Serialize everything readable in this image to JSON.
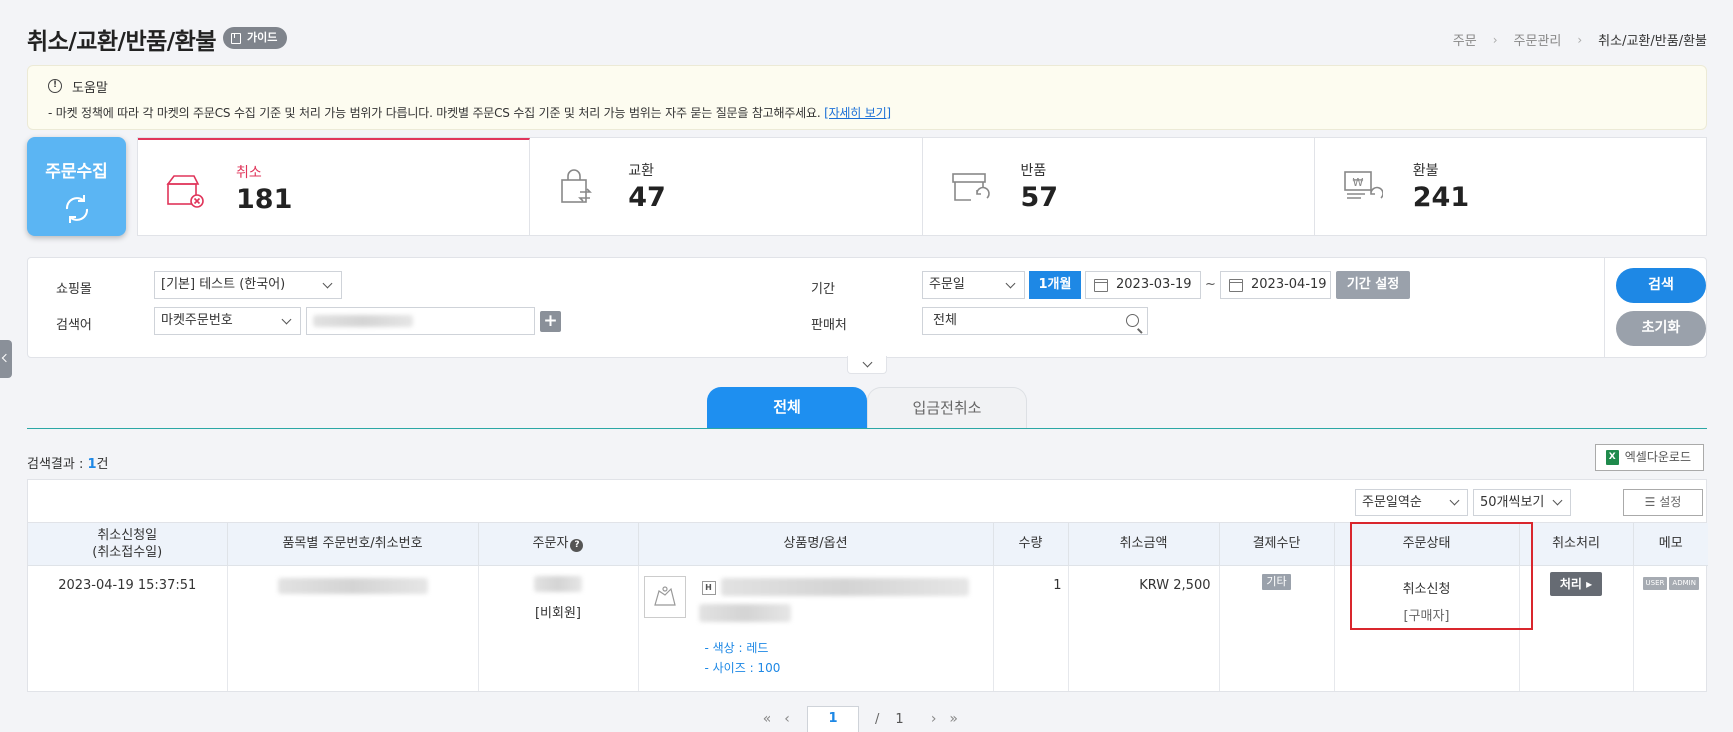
{
  "header": {
    "title": "취소/교환/반품/환불",
    "guide_label": "가이드",
    "breadcrumb": [
      "주문",
      "주문관리",
      "취소/교환/반품/환불"
    ]
  },
  "help": {
    "title": "도움말",
    "text": "- 마켓 정책에 따라 각 마켓의 주문CS 수집 기준 및 처리 가능 범위가 다릅니다. 마켓별 주문CS 수집 기준 및 처리 가능 범위는 자주 묻는 질문을 참고해주세요.",
    "link": "[자세히 보기]"
  },
  "collect": {
    "label": "주문수집"
  },
  "stats": [
    {
      "label": "취소",
      "value": "181",
      "icon": "cancel-box-icon"
    },
    {
      "label": "교환",
      "value": "47",
      "icon": "exchange-bag-icon"
    },
    {
      "label": "반품",
      "value": "57",
      "icon": "return-store-icon"
    },
    {
      "label": "환불",
      "value": "241",
      "icon": "refund-won-icon"
    }
  ],
  "search": {
    "mall_label": "쇼핑몰",
    "mall_value": "[기본] 테스트 (한국어)",
    "keyword_label": "검색어",
    "keyword_type": "마켓주문번호",
    "period_label": "기간",
    "period_type": "주문일",
    "month_btn": "1개월",
    "date_from": "2023-03-19",
    "date_sep": "~",
    "date_to": "2023-04-19",
    "period_set": "기간 설정",
    "seller_label": "판매처",
    "seller_value": "전체",
    "search_btn": "검색",
    "reset_btn": "초기화"
  },
  "tabs": [
    {
      "label": "전체"
    },
    {
      "label": "입금전취소"
    }
  ],
  "result": {
    "prefix": "검색결과 : ",
    "count": "1",
    "suffix": "건"
  },
  "excel_label": "엑셀다운로드",
  "toolbar": {
    "sort": "주문일역순",
    "page_size": "50개씩보기",
    "settings": "설정"
  },
  "columns": [
    "취소신청일\n(취소접수일)",
    "품목별 주문번호/취소번호",
    "주문자",
    "상품명/옵션",
    "수량",
    "취소금액",
    "결제수단",
    "주문상태",
    "취소처리",
    "메모"
  ],
  "row": {
    "date": "2023-04-19 15:37:51",
    "orderer_type": "[비회원]",
    "option_color": "- 색상 : 레드",
    "option_size": "- 사이즈 : 100",
    "qty": "1",
    "amount": "KRW 2,500",
    "payment": "기타",
    "status": "취소신청",
    "status_sub": "[구매자]",
    "process_btn": "처리",
    "memo_user": "USER",
    "memo_admin": "ADMIN"
  },
  "pagination": {
    "current": "1",
    "sep": "/",
    "total": "1"
  },
  "colors": {
    "accent": "#1e88e5",
    "cancel": "#e0355a",
    "highlight": "#d9262d"
  }
}
